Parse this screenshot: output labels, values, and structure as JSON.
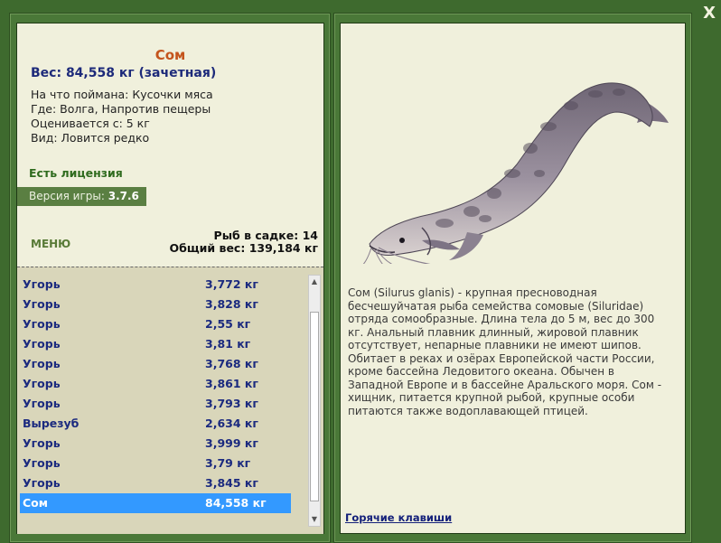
{
  "close_label": "X",
  "fish": {
    "name": "Сом",
    "weight_line": "Вес: 84,558 кг (зачетная)",
    "bait_line": "На что поймана: Кусочки мяса",
    "place_line": "Где: Волга, Напротив пещеры",
    "rated_line": "Оценивается с: 5 кг",
    "kind_line": "Вид: Ловится редко"
  },
  "license_label": "Есть лицензия",
  "version": {
    "label": "Версия игры:",
    "value": "3.7.6"
  },
  "menu_label": "МЕНЮ",
  "stats": {
    "count_line": "Рыб в садке: 14",
    "total_line": "Общий вес: 139,184 кг"
  },
  "catch_list": [
    {
      "name": "Угорь",
      "weight": "3,772 кг"
    },
    {
      "name": "Угорь",
      "weight": "3,828 кг"
    },
    {
      "name": "Угорь",
      "weight": "2,55 кг"
    },
    {
      "name": "Угорь",
      "weight": "3,81 кг"
    },
    {
      "name": "Угорь",
      "weight": "3,768 кг"
    },
    {
      "name": "Угорь",
      "weight": "3,861 кг"
    },
    {
      "name": "Угорь",
      "weight": "3,793 кг"
    },
    {
      "name": "Вырезуб",
      "weight": "2,634 кг"
    },
    {
      "name": "Угорь",
      "weight": "3,999 кг"
    },
    {
      "name": "Угорь",
      "weight": "3,79 кг"
    },
    {
      "name": "Угорь",
      "weight": "3,845 кг"
    },
    {
      "name": "Сом",
      "weight": "84,558 кг"
    }
  ],
  "description": "Сом (Silurus glanis) - крупная пресноводная бесчешуйчатая рыба семейства сомовые (Siluridae) отряда сомообразные. Длина тела до 5 м, вес до 300 кг. Анальный плавник длинный, жировой плавник отсутствует, непарные плавники не имеют шипов. Обитает в реках и озёрах Европейской части России, кроме бассейна Ледовитого океана. Обычен в Западной Европе и в бассейне Аральского моря. Сом - хищник, питается крупной рыбой, крупные особи питаются также водоплавающей птицей.",
  "hotkeys_label": "Горячие клавиши",
  "icons": {
    "close": "close-icon",
    "scroll_up": "scroll-up-arrow-icon",
    "scroll_down": "scroll-down-arrow-icon",
    "fish_image": "catfish-illustration"
  },
  "colors": {
    "frame_green": "#4a7838",
    "panel_bg": "#f0f0dc",
    "list_bg": "#d9d6ba",
    "selection": "#3399ff",
    "fish_name": "#c4541c",
    "link_blue": "#1b2a7f"
  }
}
